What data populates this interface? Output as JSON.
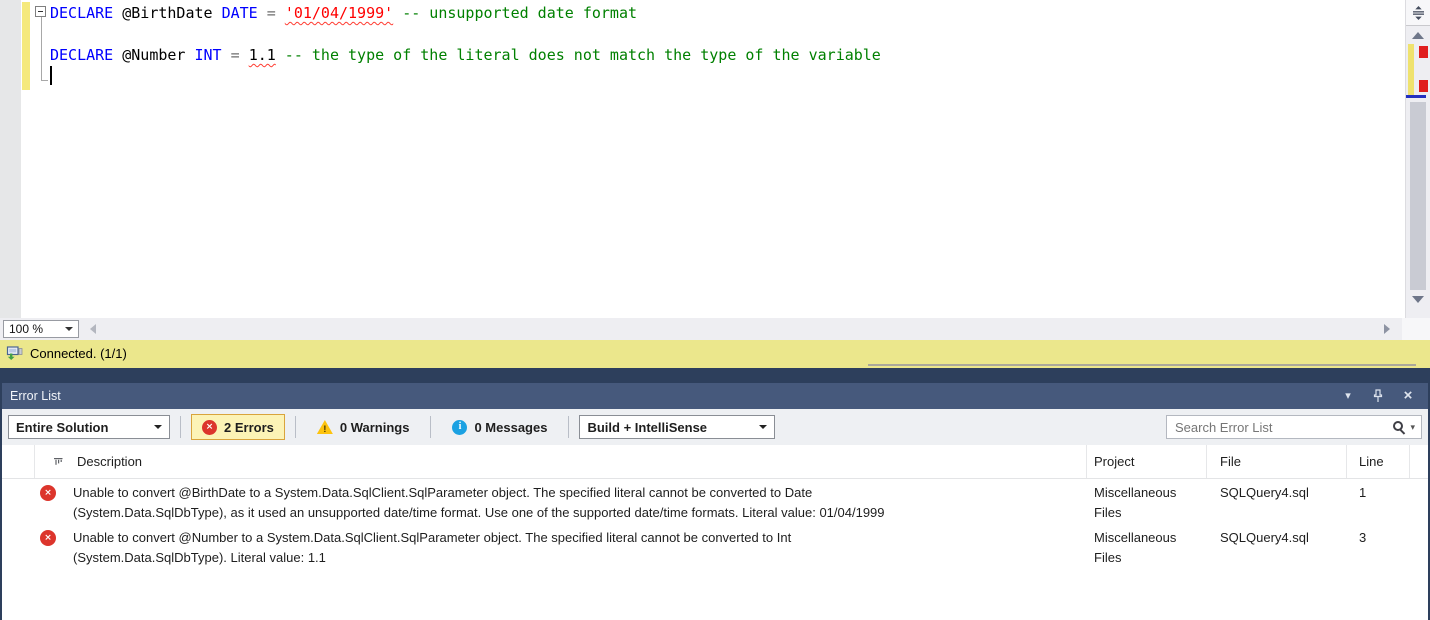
{
  "colors": {
    "error_red": "#dc352c",
    "warning_yellow": "#fdc30e",
    "info_blue": "#1ba1e2",
    "status_bar_yellow": "#ebe78c",
    "change_bar_yellow": "#f5e97c",
    "panel_title_blue": "#46597c",
    "keyword_blue": "#0000ff",
    "comment_green": "#008000",
    "string_red": "#ff0000",
    "errors_button_highlight": "#fcf3b6"
  },
  "icons": {
    "x_glyph": "×",
    "warning_glyph": "!",
    "info_glyph": "i",
    "chevron_down": "▾",
    "close_glyph": "×",
    "search_dropdown": "▾"
  },
  "editor": {
    "code": {
      "line1": {
        "keyword1": "DECLARE ",
        "variable": "@BirthDate ",
        "type": "DATE ",
        "operator": "= ",
        "literal": "'01/04/1999'",
        "comment": " -- unsupported date format"
      },
      "line2": {
        "keyword1": "DECLARE ",
        "variable": "@Number ",
        "type": "INT ",
        "operator": "= ",
        "literal": "1.1",
        "comment": " -- the type of the literal does not match the type of the variable"
      }
    },
    "zoom_level": "100 %",
    "status_text": "Connected. (1/1)"
  },
  "error_list": {
    "title": "Error List",
    "scope_filter": "Entire Solution",
    "errors_button": "2 Errors",
    "warnings_button": "0 Warnings",
    "messages_button": "0 Messages",
    "source_filter": "Build + IntelliSense",
    "search_placeholder": "Search Error List",
    "columns": {
      "description": "Description",
      "project": "Project",
      "file": "File",
      "line": "Line"
    },
    "rows": [
      {
        "description": "Unable to convert @BirthDate to a System.Data.SqlClient.SqlParameter object. The specified literal cannot be converted to Date\n(System.Data.SqlDbType), as it used an unsupported date/time format. Use one of the supported date/time formats. Literal value: 01/04/1999",
        "project": "Miscellaneous Files",
        "file": "SQLQuery4.sql",
        "line": "1"
      },
      {
        "description": "Unable to convert @Number to a System.Data.SqlClient.SqlParameter object. The specified literal cannot be converted to Int\n(System.Data.SqlDbType). Literal value: 1.1",
        "project": "Miscellaneous Files",
        "file": "SQLQuery4.sql",
        "line": "3"
      }
    ]
  }
}
